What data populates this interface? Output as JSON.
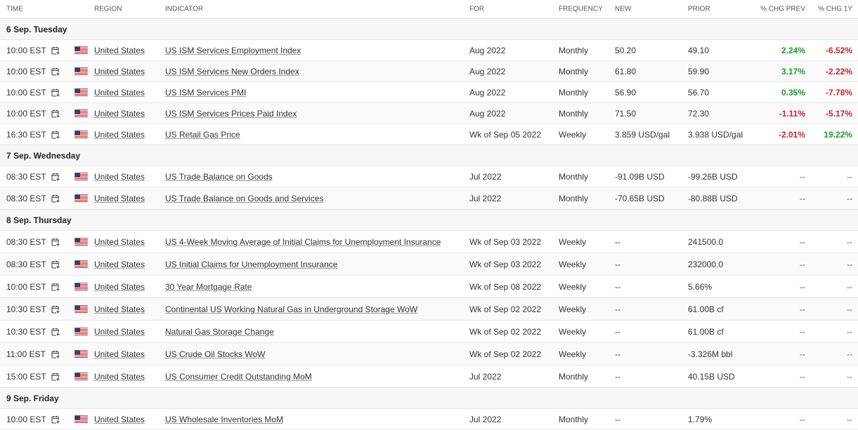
{
  "header": {
    "time": "TIME",
    "region": "REGION",
    "indicator": "INDICATOR",
    "for": "FOR",
    "frequency": "FREQUENCY",
    "new": "NEW",
    "prior": "PRIOR",
    "chg_prev": "% CHG PREV",
    "chg_1y": "% CHG 1Y"
  },
  "icons": {
    "calendar": "calendar-add-icon",
    "flag": "us-flag-icon"
  },
  "colors": {
    "positive": "#1f9b2e",
    "negative": "#d0222a"
  },
  "groups": [
    {
      "label": "6 Sep. Tuesday",
      "rows": [
        {
          "time": "10:00 EST",
          "region": "United States",
          "indicator": "US ISM Services Employment Index",
          "for": "Aug 2022",
          "frequency": "Monthly",
          "new": "50.20",
          "prior": "49.10",
          "chg_prev": "2.24%",
          "chg_1y": "-6.52%"
        },
        {
          "time": "10:00 EST",
          "region": "United States",
          "indicator": "US ISM Services New Orders Index",
          "for": "Aug 2022",
          "frequency": "Monthly",
          "new": "61.80",
          "prior": "59.90",
          "chg_prev": "3.17%",
          "chg_1y": "-2.22%"
        },
        {
          "time": "10:00 EST",
          "region": "United States",
          "indicator": "US ISM Services PMI",
          "for": "Aug 2022",
          "frequency": "Monthly",
          "new": "56.90",
          "prior": "56.70",
          "chg_prev": "0.35%",
          "chg_1y": "-7.78%"
        },
        {
          "time": "10:00 EST",
          "region": "United States",
          "indicator": "US ISM Services Prices Paid Index",
          "for": "Aug 2022",
          "frequency": "Monthly",
          "new": "71.50",
          "prior": "72.30",
          "chg_prev": "-1.11%",
          "chg_1y": "-5.17%"
        },
        {
          "time": "16:30 EST",
          "region": "United States",
          "indicator": "US Retail Gas Price",
          "for": "Wk of Sep 05 2022",
          "frequency": "Weekly",
          "new": "3.859 USD/gal",
          "prior": "3.938 USD/gal",
          "chg_prev": "-2.01%",
          "chg_1y": "19.22%"
        }
      ]
    },
    {
      "label": "7 Sep. Wednesday",
      "rows": [
        {
          "time": "08:30 EST",
          "region": "United States",
          "indicator": "US Trade Balance on Goods",
          "for": "Jul 2022",
          "frequency": "Monthly",
          "new": "-91.09B USD",
          "prior": "-99.26B USD",
          "chg_prev": "--",
          "chg_1y": "--"
        },
        {
          "time": "08:30 EST",
          "region": "United States",
          "indicator": "US Trade Balance on Goods and Services",
          "for": "Jul 2022",
          "frequency": "Monthly",
          "new": "-70.65B USD",
          "prior": "-80.88B USD",
          "chg_prev": "--",
          "chg_1y": "--"
        }
      ]
    },
    {
      "label": "8 Sep. Thursday",
      "rows": [
        {
          "time": "08:30 EST",
          "region": "United States",
          "indicator": "US 4-Week Moving Average of Initial Claims for Unemployment Insurance",
          "for": "Wk of Sep 03 2022",
          "frequency": "Weekly",
          "new": "--",
          "prior": "241500.0",
          "chg_prev": "--",
          "chg_1y": "--"
        },
        {
          "time": "08:30 EST",
          "region": "United States",
          "indicator": "US Initial Claims for Unemployment Insurance",
          "for": "Wk of Sep 03 2022",
          "frequency": "Weekly",
          "new": "--",
          "prior": "232000.0",
          "chg_prev": "--",
          "chg_1y": "--"
        },
        {
          "time": "10:00 EST",
          "region": "United States",
          "indicator": "30 Year Mortgage Rate",
          "for": "Wk of Sep 08 2022",
          "frequency": "Weekly",
          "new": "--",
          "prior": "5.66%",
          "chg_prev": "--",
          "chg_1y": "--"
        },
        {
          "time": "10:30 EST",
          "region": "United States",
          "indicator": "Continental US Working Natural Gas in Underground Storage WoW",
          "for": "Wk of Sep 02 2022",
          "frequency": "Weekly",
          "new": "--",
          "prior": "61.00B cf",
          "chg_prev": "--",
          "chg_1y": "--"
        },
        {
          "time": "10:30 EST",
          "region": "United States",
          "indicator": "Natural Gas Storage Change",
          "for": "Wk of Sep 02 2022",
          "frequency": "Weekly",
          "new": "--",
          "prior": "61.00B cf",
          "chg_prev": "--",
          "chg_1y": "--"
        },
        {
          "time": "11:00 EST",
          "region": "United States",
          "indicator": "US Crude Oil Stocks WoW",
          "for": "Wk of Sep 02 2022",
          "frequency": "Weekly",
          "new": "--",
          "prior": "-3.326M bbl",
          "chg_prev": "--",
          "chg_1y": "--"
        },
        {
          "time": "15:00 EST",
          "region": "United States",
          "indicator": "US Consumer Credit Outstanding MoM",
          "for": "Jul 2022",
          "frequency": "Monthly",
          "new": "--",
          "prior": "40.15B USD",
          "chg_prev": "--",
          "chg_1y": "--"
        }
      ]
    },
    {
      "label": "9 Sep. Friday",
      "rows": [
        {
          "time": "10:00 EST",
          "region": "United States",
          "indicator": "US Wholesale Inventories MoM",
          "for": "Jul 2022",
          "frequency": "Monthly",
          "new": "--",
          "prior": "1.79%",
          "chg_prev": "--",
          "chg_1y": "--"
        }
      ]
    }
  ]
}
